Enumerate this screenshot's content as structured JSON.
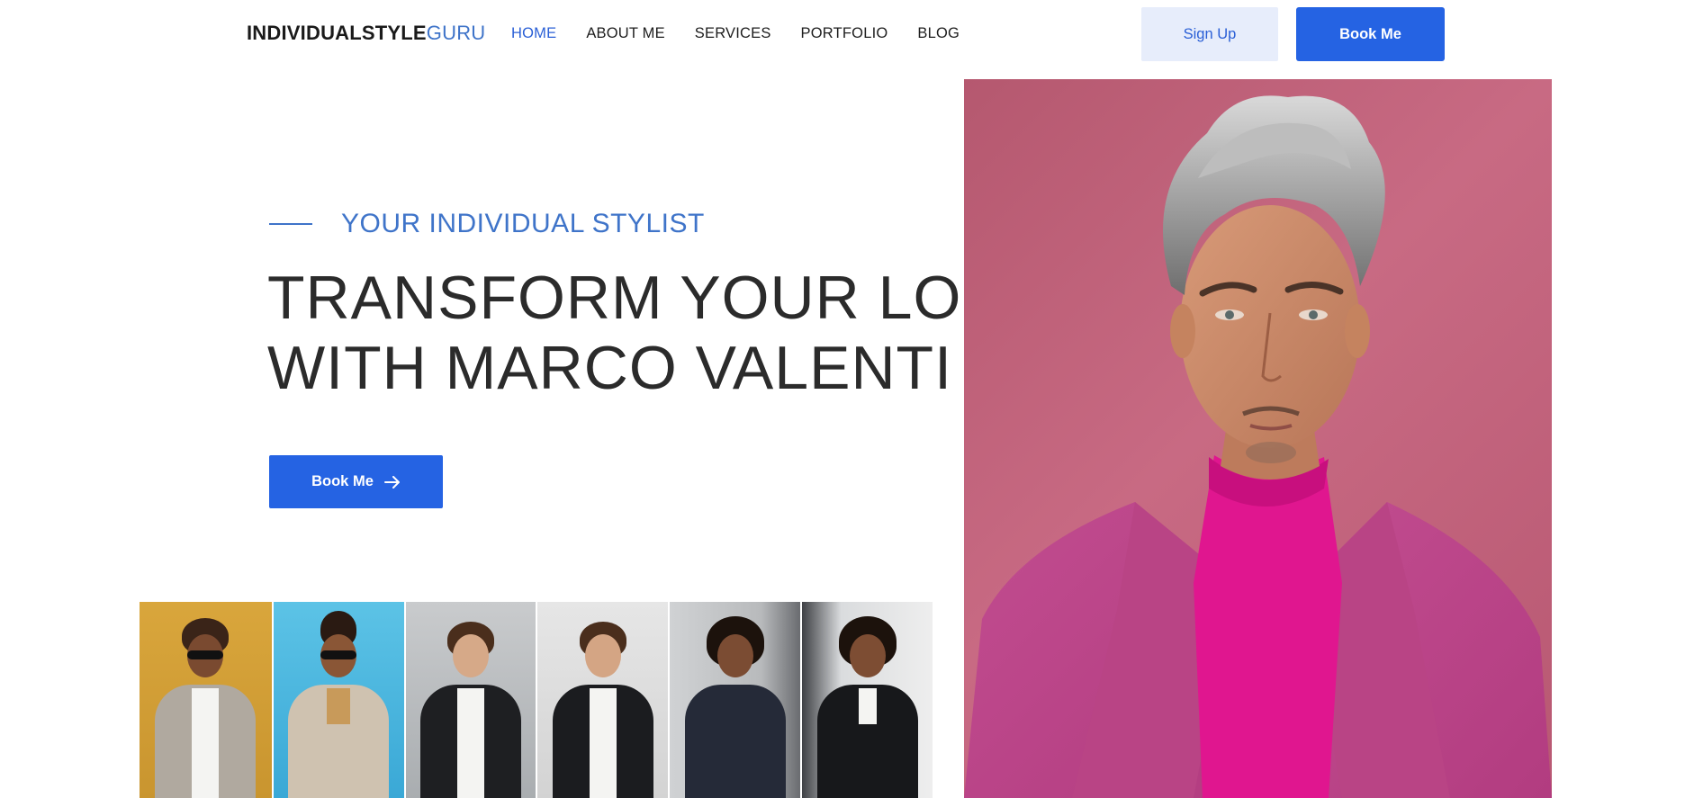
{
  "header": {
    "logo_bold": "INDIVIDUALSTYLE",
    "logo_light": "GURU",
    "nav": [
      {
        "label": "HOME",
        "active": true
      },
      {
        "label": "ABOUT ME",
        "active": false
      },
      {
        "label": "SERVICES",
        "active": false
      },
      {
        "label": "PORTFOLIO",
        "active": false
      },
      {
        "label": "BLOG",
        "active": false
      }
    ],
    "signup_label": "Sign Up",
    "book_label": "Book Me"
  },
  "hero": {
    "eyebrow": "YOUR INDIVIDUAL STYLIST",
    "headline_line1": "TRANSFORM YOUR LOOK",
    "headline_line2": "WITH MARCO VALENTI",
    "cta_label": "Book Me",
    "cta_icon": "arrow-right-icon"
  },
  "colors": {
    "accent": "#2563e3",
    "accent_light": "#e7edfb",
    "eyebrow": "#3f74c9",
    "portrait_bg": "#c86a83",
    "turtleneck": "#e0168f",
    "blazer": "#c94a92"
  }
}
